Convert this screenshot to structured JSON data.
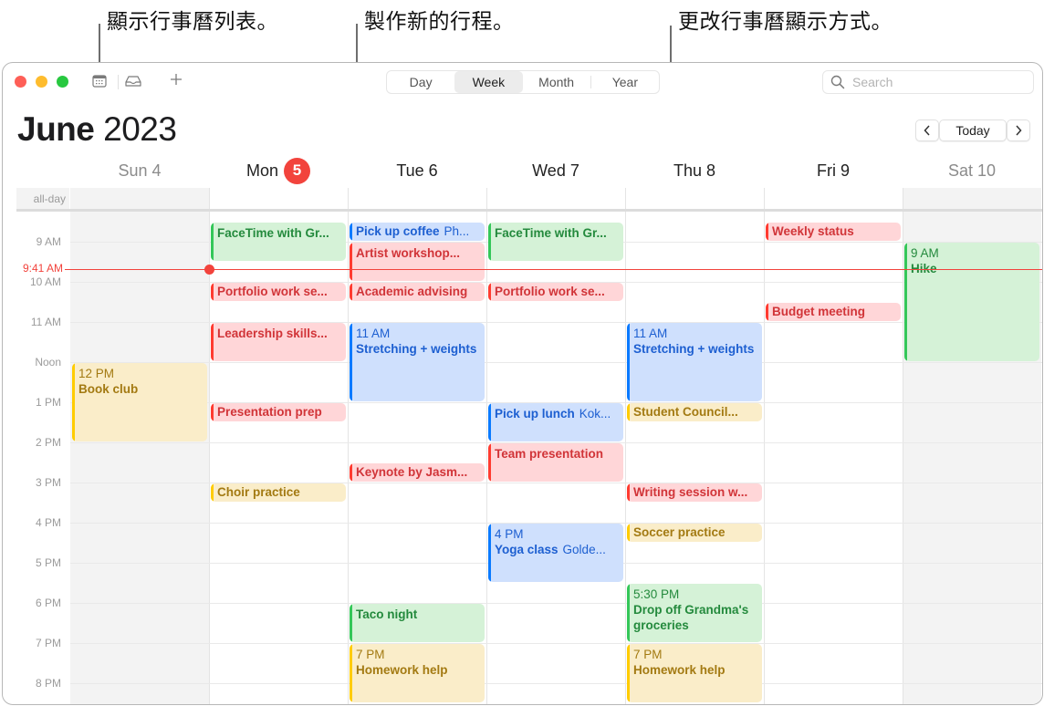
{
  "callouts": {
    "calendar_list": "顯示行事曆列表。",
    "new_event": "製作新的行程。",
    "change_view": "更改行事曆顯示方式。"
  },
  "toolbar": {
    "icons": [
      "calendar-list-icon",
      "inbox-icon",
      "plus-icon"
    ],
    "views": [
      {
        "label": "Day",
        "active": false
      },
      {
        "label": "Week",
        "active": true
      },
      {
        "label": "Month",
        "active": false
      },
      {
        "label": "Year",
        "active": false
      }
    ],
    "search_placeholder": "Search"
  },
  "header": {
    "month": "June",
    "year": "2023",
    "prev_label": "‹",
    "today_label": "Today",
    "next_label": "›"
  },
  "days": [
    {
      "label": "Sun 4",
      "weekend": true
    },
    {
      "label": "Mon",
      "badge": "5",
      "today": true
    },
    {
      "label": "Tue 6"
    },
    {
      "label": "Wed 7"
    },
    {
      "label": "Thu 8"
    },
    {
      "label": "Fri 9"
    },
    {
      "label": "Sat 10",
      "weekend": true
    }
  ],
  "allday_label": "all-day",
  "hours": [
    "9 AM",
    "10 AM",
    "11 AM",
    "Noon",
    "1 PM",
    "2 PM",
    "3 PM",
    "4 PM",
    "5 PM",
    "6 PM",
    "7 PM",
    "8 PM"
  ],
  "now": {
    "label": "9:41 AM",
    "hour": 9.683
  },
  "colors": {
    "green": "#34c759",
    "red": "#ff3b30",
    "blue": "#0a7aff",
    "yellow": "#ffcc00",
    "today_badge": "#f2433c"
  },
  "events": [
    {
      "day": 0,
      "start": 12,
      "end": 14,
      "color": "yellow",
      "time": "12 PM",
      "title": "Book club"
    },
    {
      "day": 1,
      "start": 8.5,
      "end": 9.5,
      "color": "green",
      "title": "FaceTime with Gr..."
    },
    {
      "day": 1,
      "start": 10,
      "end": 10.5,
      "color": "red",
      "title": "Portfolio work se..."
    },
    {
      "day": 1,
      "start": 11,
      "end": 12,
      "color": "red",
      "title": "Leadership skills..."
    },
    {
      "day": 1,
      "start": 13,
      "end": 13.5,
      "color": "red",
      "title": "Presentation prep"
    },
    {
      "day": 1,
      "start": 15,
      "end": 15.5,
      "color": "yellow",
      "title": "Choir practice"
    },
    {
      "day": 2,
      "start": 8.5,
      "end": 9,
      "color": "blue",
      "title": "Pick up coffee",
      "location": "Ph..."
    },
    {
      "day": 2,
      "start": 9,
      "end": 10,
      "color": "red",
      "title": "Artist workshop..."
    },
    {
      "day": 2,
      "start": 10,
      "end": 10.5,
      "color": "red",
      "title": "Academic advising"
    },
    {
      "day": 2,
      "start": 11,
      "end": 13,
      "color": "blue",
      "time": "11 AM",
      "title": "Stretching + weights"
    },
    {
      "day": 2,
      "start": 14.5,
      "end": 15,
      "color": "red",
      "title": "Keynote by Jasm..."
    },
    {
      "day": 2,
      "start": 18,
      "end": 19,
      "color": "green",
      "title": "Taco night"
    },
    {
      "day": 2,
      "start": 19,
      "end": 20.5,
      "color": "yellow",
      "time": "7 PM",
      "title": "Homework help"
    },
    {
      "day": 3,
      "start": 8.5,
      "end": 9.5,
      "color": "green",
      "title": "FaceTime with Gr..."
    },
    {
      "day": 3,
      "start": 10,
      "end": 10.5,
      "color": "red",
      "title": "Portfolio work se..."
    },
    {
      "day": 3,
      "start": 13,
      "end": 14,
      "color": "blue",
      "title": "Pick up lunch",
      "location": "Kok..."
    },
    {
      "day": 3,
      "start": 14,
      "end": 15,
      "color": "red",
      "title": "Team presentation"
    },
    {
      "day": 3,
      "start": 16,
      "end": 17.5,
      "color": "blue",
      "time": "4 PM",
      "title": "Yoga class",
      "location": "Golde..."
    },
    {
      "day": 4,
      "start": 11,
      "end": 13,
      "color": "blue",
      "time": "11 AM",
      "title": "Stretching + weights"
    },
    {
      "day": 4,
      "start": 13,
      "end": 13.5,
      "color": "yellow",
      "title": "Student Council..."
    },
    {
      "day": 4,
      "start": 15,
      "end": 15.5,
      "color": "red",
      "title": "Writing session w..."
    },
    {
      "day": 4,
      "start": 16,
      "end": 16.5,
      "color": "yellow",
      "title": "Soccer practice"
    },
    {
      "day": 4,
      "start": 17.5,
      "end": 19,
      "color": "green",
      "time": "5:30 PM",
      "title": "Drop off Grandma's groceries"
    },
    {
      "day": 4,
      "start": 19,
      "end": 20.5,
      "color": "yellow",
      "time": "7 PM",
      "title": "Homework help"
    },
    {
      "day": 5,
      "start": 8.5,
      "end": 9,
      "color": "red",
      "title": "Weekly status"
    },
    {
      "day": 5,
      "start": 10.5,
      "end": 11,
      "color": "red",
      "title": "Budget meeting"
    },
    {
      "day": 6,
      "start": 9,
      "end": 12,
      "color": "green",
      "time": "9 AM",
      "title": "Hike"
    }
  ]
}
